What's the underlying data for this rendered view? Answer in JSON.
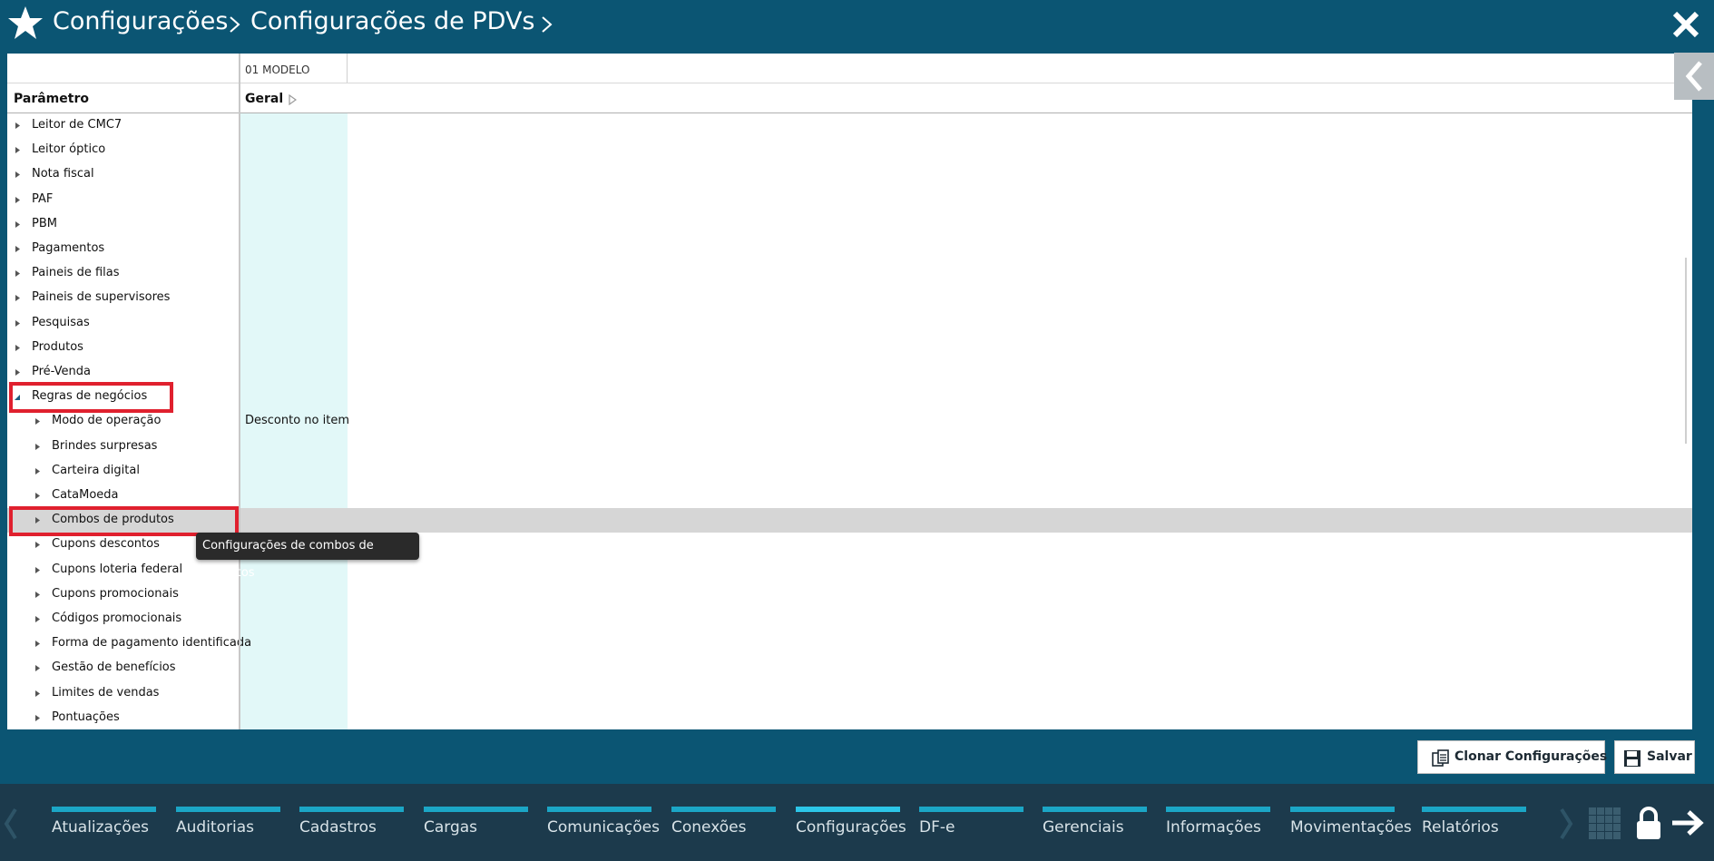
{
  "header": {
    "breadcrumb": [
      "Configurações",
      "Configurações de PDVs"
    ]
  },
  "grid": {
    "model_column": "01 MODELO",
    "param_header": "Parâmetro",
    "group_header": "Geral",
    "rows": [
      {
        "label": "Leitor de CMC7",
        "value": ""
      },
      {
        "label": "Leitor óptico",
        "value": ""
      },
      {
        "label": "Nota fiscal",
        "value": ""
      },
      {
        "label": "PAF",
        "value": ""
      },
      {
        "label": "PBM",
        "value": ""
      },
      {
        "label": "Pagamentos",
        "value": ""
      },
      {
        "label": "Paineis de filas",
        "value": ""
      },
      {
        "label": "Paineis de supervisores",
        "value": ""
      },
      {
        "label": "Pesquisas",
        "value": ""
      },
      {
        "label": "Produtos",
        "value": ""
      },
      {
        "label": "Pré-Venda",
        "value": ""
      },
      {
        "label": "Regras de negócios",
        "value": ""
      },
      {
        "label": "Modo de operação",
        "value": "Desconto no item"
      },
      {
        "label": "Brindes surpresas",
        "value": ""
      },
      {
        "label": "Carteira digital",
        "value": ""
      },
      {
        "label": "CataMoeda",
        "value": ""
      },
      {
        "label": "Combos de produtos",
        "value": ""
      },
      {
        "label": "Cupons descontos",
        "value": ""
      },
      {
        "label": "Cupons loteria federal",
        "value": ""
      },
      {
        "label": "Cupons promocionais",
        "value": ""
      },
      {
        "label": "Códigos promocionais",
        "value": ""
      },
      {
        "label": "Forma de pagamento identificada",
        "value": ""
      },
      {
        "label": "Gestão de benefícios",
        "value": ""
      },
      {
        "label": "Limites de vendas",
        "value": ""
      },
      {
        "label": "Pontuações",
        "value": ""
      }
    ],
    "tooltip": "Configurações de combos de produtos"
  },
  "actions": {
    "clone_label": "Clonar Configurações",
    "save_label": "Salvar"
  },
  "bottom_nav": {
    "active": "Configurações",
    "items": [
      "Atualizações",
      "Auditorias",
      "Cadastros",
      "Cargas",
      "Comunicações",
      "Conexões",
      "Configurações",
      "DF-e",
      "Gerenciais",
      "Informações",
      "Movimentações",
      "Relatórios"
    ]
  },
  "colors": {
    "header_bg": "#0b5573",
    "bottom_bg": "#1c3a4c",
    "accent": "#1ba6c6",
    "highlight_border": "#e0202e",
    "value_column_bg": "#e2f8f8"
  }
}
